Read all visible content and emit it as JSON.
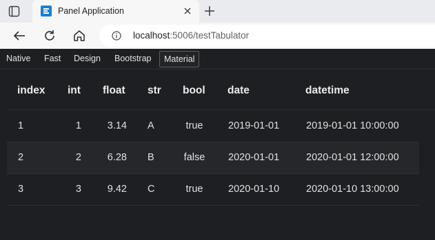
{
  "browser": {
    "tab_title": "Panel Application",
    "url_host": "localhost",
    "url_path": ":5006/testTabulator",
    "favicon_color": "#1d7fd2"
  },
  "theme_tabs": [
    "Native",
    "Fast",
    "Design",
    "Bootstrap",
    "Material"
  ],
  "active_theme": "Material",
  "table": {
    "columns": [
      "index",
      "int",
      "float",
      "str",
      "bool",
      "date",
      "datetime"
    ],
    "rows": [
      [
        "1",
        "1",
        "3.14",
        "A",
        "true",
        "2019-01-01",
        "2019-01-01 10:00:00"
      ],
      [
        "2",
        "2",
        "6.28",
        "B",
        "false",
        "2020-01-01",
        "2020-01-01 12:00:00"
      ],
      [
        "3",
        "3",
        "9.42",
        "C",
        "true",
        "2020-01-10",
        "2020-01-10 13:00:00"
      ]
    ]
  },
  "colors": {
    "background": "#1e1f22",
    "alt_row": "#26272a",
    "chrome": "#f7f7f7"
  }
}
